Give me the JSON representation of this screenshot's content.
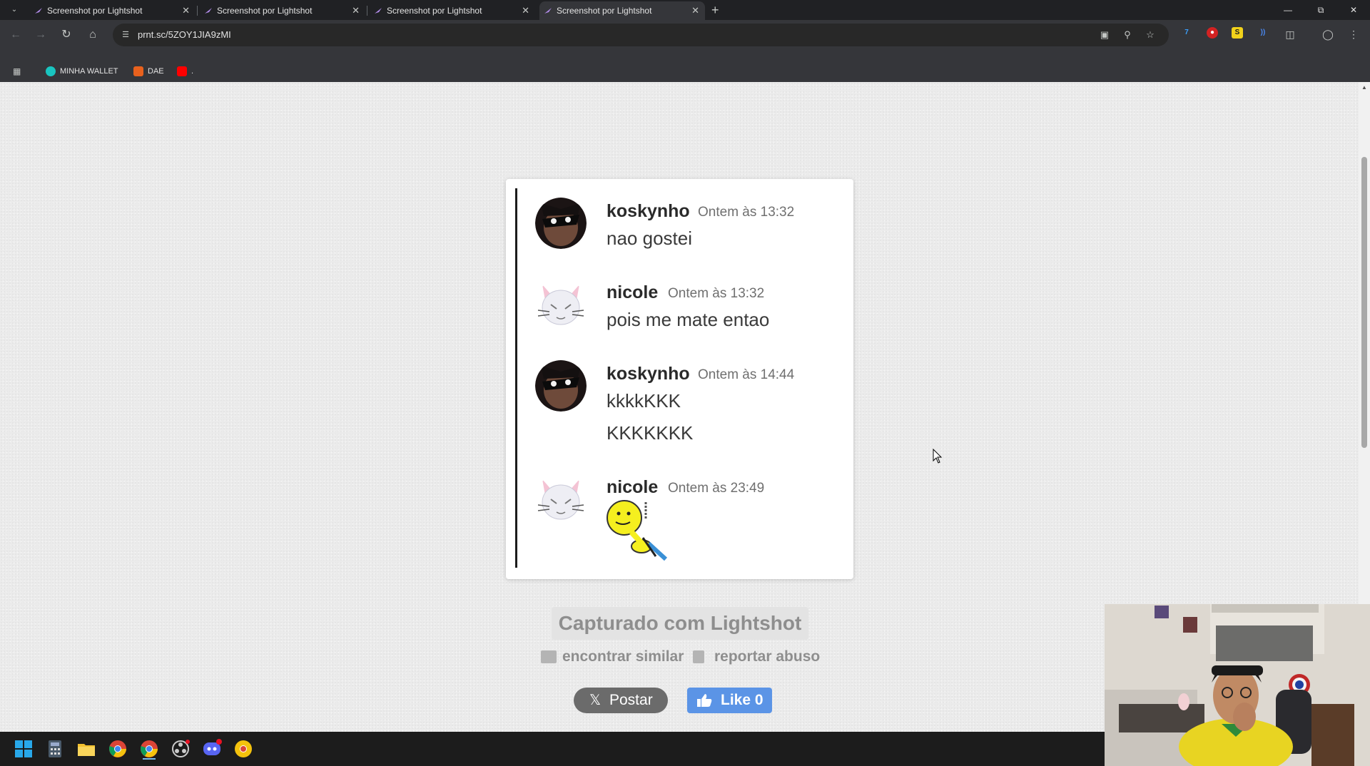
{
  "browser": {
    "tabs": [
      {
        "title": "Screenshot por Lightshot",
        "active": false
      },
      {
        "title": "Screenshot por Lightshot",
        "active": false
      },
      {
        "title": "Screenshot por Lightshot",
        "active": false
      },
      {
        "title": "Screenshot por Lightshot",
        "active": true
      }
    ],
    "new_tab_label": "+",
    "url": "prnt.sc/5ZOY1JIA9zMI",
    "bookmarks": [
      {
        "label": "MINHA WALLET",
        "icon": "wallet-icon"
      },
      {
        "label": "DAE",
        "icon": "dae-icon"
      },
      {
        "label": ".",
        "icon": "youtube-icon"
      }
    ]
  },
  "screenshot": {
    "messages": [
      {
        "user": "koskynho",
        "time": "Ontem às 13:32",
        "lines": [
          "nao gostei"
        ],
        "avatar": "masked-hero-avatar"
      },
      {
        "user": "nicole",
        "time": "Ontem às 13:32",
        "lines": [
          "pois me mate entao"
        ],
        "avatar": "white-cat-avatar"
      },
      {
        "user": "koskynho",
        "time": "Ontem às 14:44",
        "lines": [
          "kkkkKKK",
          "KKKKKKK"
        ],
        "avatar": "masked-hero-avatar"
      },
      {
        "user": "nicole",
        "time": "Ontem às 23:49",
        "lines": [],
        "avatar": "white-cat-avatar",
        "sticker": "smiley-knife-sticker"
      }
    ]
  },
  "lightshot": {
    "captured": "Capturado com Lightshot",
    "find_similar": "encontrar similar",
    "report_abuse": "reportar abuso",
    "post": "Postar",
    "like": "Like 0"
  },
  "colors": {
    "page_bg": "#ebebeb",
    "like_blue": "#5b94e6",
    "post_gray": "#6b6b6b"
  }
}
